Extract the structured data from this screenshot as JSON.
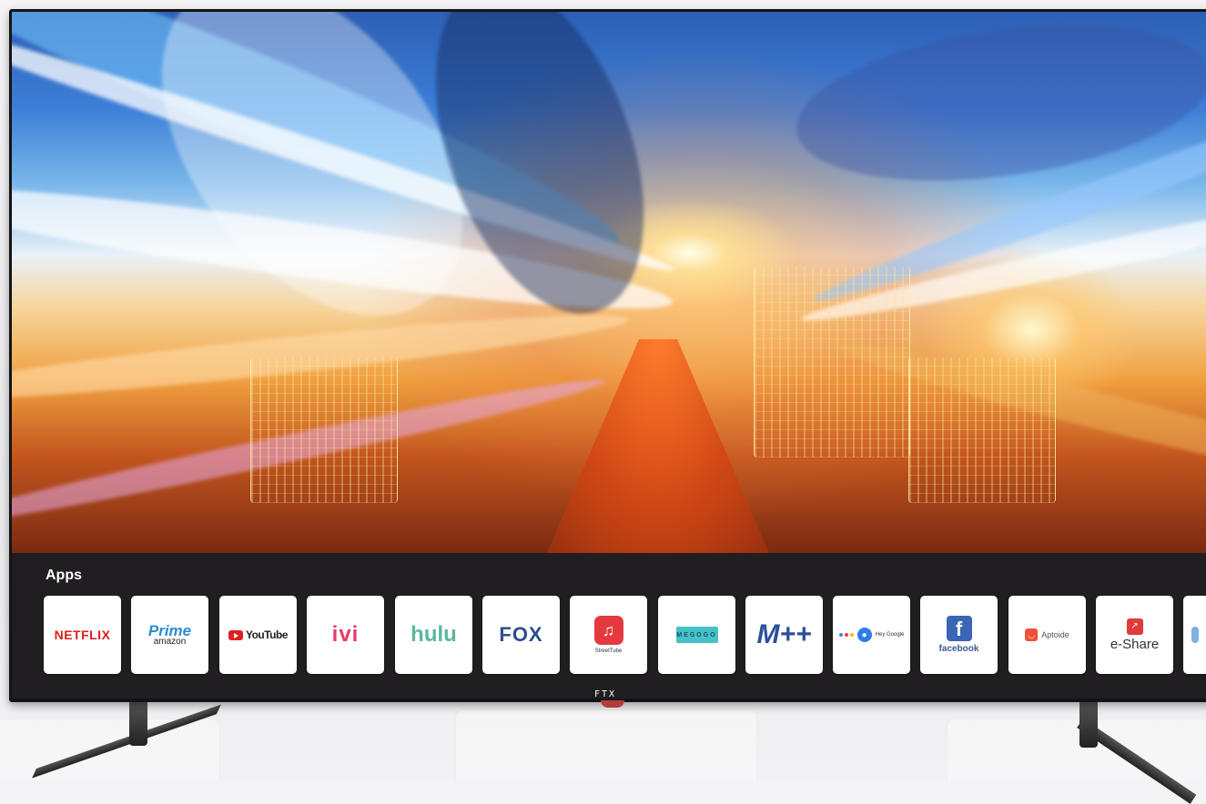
{
  "brand": {
    "logo_text": "FTX"
  },
  "apps_section": {
    "title": "Apps",
    "tiles": [
      {
        "label": "NETFLIX",
        "icon": "netflix-logo",
        "color": "#d8221b"
      },
      {
        "label": "Prime",
        "sublabel": "amazon",
        "icon": "prime-video-logo",
        "color": "#2a8ed0"
      },
      {
        "label": "YouTube",
        "icon": "youtube-logo",
        "color": "#e02020"
      },
      {
        "label": "ivi",
        "icon": "ivi-logo",
        "color": "#e83b6a"
      },
      {
        "label": "hulu",
        "icon": "hulu-logo",
        "color": "#5bb6a0"
      },
      {
        "label": "FOX",
        "icon": "fox-logo",
        "color": "#2a4f8d"
      },
      {
        "label": "StreetTube",
        "icon": "music-note-icon",
        "color": "#e43a3f"
      },
      {
        "label": "MEGOGO",
        "icon": "megogo-logo",
        "color": "#46c2c6"
      },
      {
        "label": "M++",
        "icon": "mpp-logo",
        "color": "#2c4f9c"
      },
      {
        "label": "Hey Google",
        "icon": "microphone-icon",
        "color": "#2d7de6"
      },
      {
        "label": "facebook",
        "icon": "facebook-icon",
        "color": "#3b65b5"
      },
      {
        "label": "Aptoide",
        "icon": "aptoide-icon",
        "color": "#f0503a"
      },
      {
        "label": "e-Share",
        "icon": "eshare-icon",
        "color": "#e03b3b"
      }
    ]
  }
}
